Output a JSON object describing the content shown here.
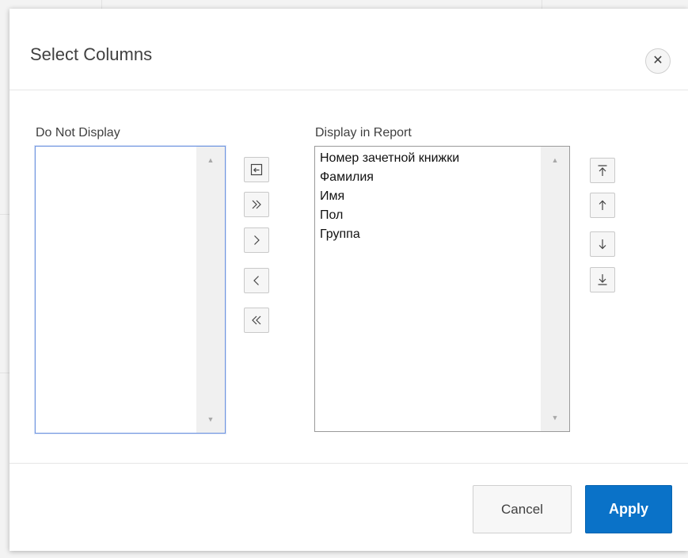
{
  "dialog": {
    "title": "Select Columns",
    "close_icon": "close-icon"
  },
  "left_list": {
    "label": "Do Not Display",
    "items": []
  },
  "right_list": {
    "label": "Display in Report",
    "items": [
      "Номер зачетной книжки",
      "Фамилия",
      "Имя",
      "Пол",
      "Группа"
    ]
  },
  "move_buttons": [
    "reset-icon",
    "move-all-right-icon",
    "move-right-icon",
    "move-left-icon",
    "move-all-left-icon"
  ],
  "order_buttons": [
    "move-to-top-icon",
    "move-up-icon",
    "move-down-icon",
    "move-to-bottom-icon"
  ],
  "footer": {
    "cancel_label": "Cancel",
    "apply_label": "Apply"
  },
  "colors": {
    "apply": "#0a72c8",
    "focus_border": "#6f95e0"
  }
}
